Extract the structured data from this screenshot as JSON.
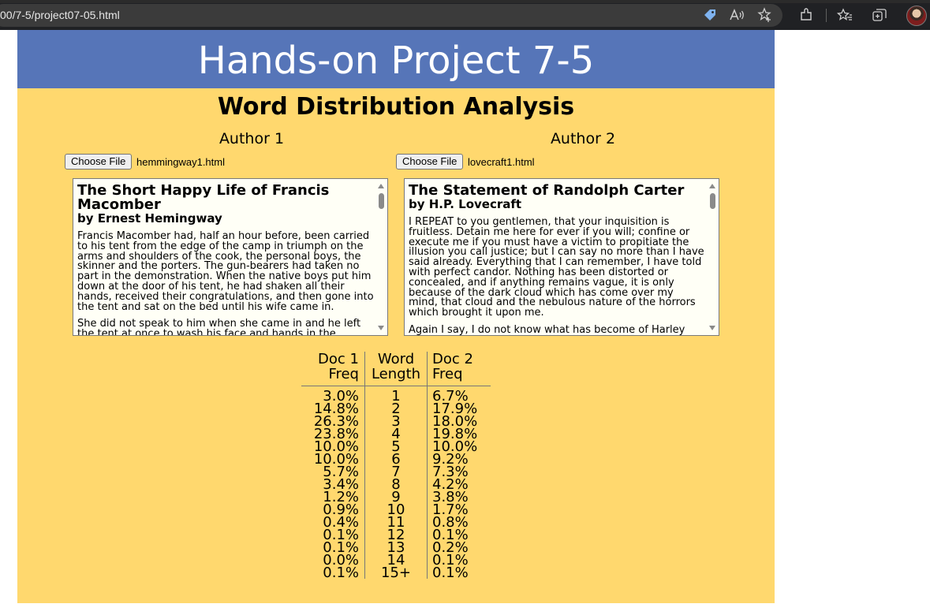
{
  "browser": {
    "url": "00/7-5/project07-05.html",
    "icons": [
      "tag-icon",
      "read-aloud-icon",
      "favorite-star-icon",
      "extensions-icon",
      "favorites-icon",
      "collections-icon",
      "profile-avatar"
    ]
  },
  "page": {
    "banner": "Hands-on Project 7-5",
    "subtitle": "Word Distribution Analysis",
    "colors": {
      "banner": "#5675b8",
      "background": "#ffd86e",
      "doc_box": "#fffff6"
    }
  },
  "author1": {
    "heading": "Author 1",
    "button": "Choose File",
    "file": "hemmingway1.html",
    "doc_title": "The Short Happy Life of Francis Macomber",
    "doc_author": "by Ernest Hemingway",
    "p1": "Francis Macomber had, half an hour before, been carried to his tent from the edge of the camp in triumph on the arms and shoulders of the cook, the personal boys, the skinner and the porters. The gun-bearers had taken no part in the demonstration. When the native boys put him down at the door of his tent, he had shaken all their hands, received their congratulations, and then gone into the tent and sat on the bed until his wife came in.",
    "p2": "She did not speak to him when she came in and he left the tent at once to wash his face and hands in the"
  },
  "author2": {
    "heading": "Author 2",
    "button": "Choose File",
    "file": "lovecraft1.html",
    "doc_title": "The Statement of Randolph Carter",
    "doc_author": "by H.P. Lovecraft",
    "p1": "I REPEAT to you gentlemen, that your inquisition is fruitless. Detain me here for ever if you will; confine or execute me if you must have a victim to propitiate the illusion you call justice; but I can say no more than I have said already. Everything that I can remember, I have told with perfect candor. Nothing has been distorted or concealed, and if anything remains vague, it is only because of the dark cloud which has come over my mind, that cloud and the nebulous nature of the horrors which brought it upon me.",
    "p2": "Again I say, I do not know what has become of Harley"
  },
  "table": {
    "head_doc1": [
      "Doc 1",
      "Freq"
    ],
    "head_word": [
      "Word",
      "Length"
    ],
    "head_doc2": [
      "Doc 2",
      "Freq"
    ],
    "doc1": [
      "3.0%",
      "14.8%",
      "26.3%",
      "23.8%",
      "10.0%",
      "10.0%",
      "5.7%",
      "3.4%",
      "1.2%",
      "0.9%",
      "0.4%",
      "0.1%",
      "0.1%",
      "0.0%",
      "0.1%"
    ],
    "length": [
      "1",
      "2",
      "3",
      "4",
      "5",
      "6",
      "7",
      "8",
      "9",
      "10",
      "11",
      "12",
      "13",
      "14",
      "15+"
    ],
    "doc2": [
      "6.7%",
      "17.9%",
      "18.0%",
      "19.8%",
      "10.0%",
      "9.2%",
      "7.3%",
      "4.2%",
      "3.8%",
      "1.7%",
      "0.8%",
      "0.1%",
      "0.2%",
      "0.1%",
      "0.1%"
    ]
  }
}
